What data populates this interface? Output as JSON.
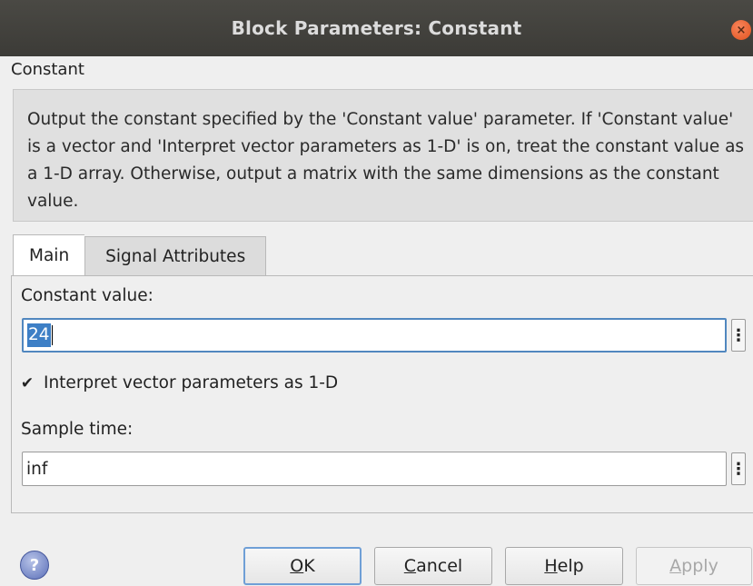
{
  "window": {
    "title": "Block Parameters: Constant",
    "close_symbol": "×"
  },
  "block": {
    "type_label": "Constant",
    "description": "Output the constant specified by the 'Constant value' parameter. If 'Constant value' is a vector and 'Interpret vector parameters as 1-D' is on, treat the constant value as a 1-D array. Otherwise, output a matrix with the same dimensions as the constant value."
  },
  "tabs": [
    {
      "label": "Main",
      "active": true
    },
    {
      "label": "Signal Attributes",
      "active": false
    }
  ],
  "main": {
    "constant_value_label": "Constant value:",
    "constant_value": "24",
    "more_symbol": "⋮",
    "interpret_label": "Interpret vector parameters as 1-D",
    "interpret_checked": true,
    "check_symbol": "✔",
    "sample_time_label": "Sample time:",
    "sample_time": "inf"
  },
  "buttons": {
    "help_icon_symbol": "?",
    "ok": {
      "mnemonic": "O",
      "rest": "K"
    },
    "cancel": {
      "mnemonic": "C",
      "rest": "ancel"
    },
    "help": {
      "mnemonic": "H",
      "rest": "elp"
    },
    "apply": {
      "mnemonic": "A",
      "rest": "pply",
      "enabled": false
    }
  },
  "colors": {
    "titlebar": "#3c3b37",
    "close": "#e0531f",
    "selection": "#3d7fc6",
    "focus_border": "#5187bf"
  }
}
